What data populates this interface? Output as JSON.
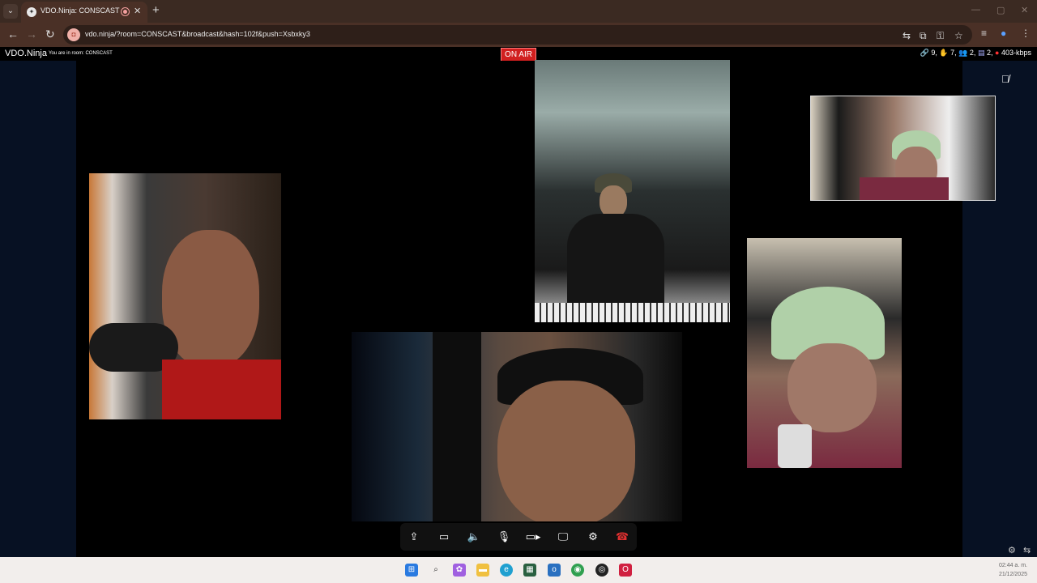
{
  "browser": {
    "tab_title": "VDO.Ninja: CONSCAST",
    "url": "vdo.ninja/?room=CONSCAST&broadcast&hash=102f&push=Xsbxky3"
  },
  "app": {
    "brand": "VDO.Ninja",
    "room_text": "You are in room: CONSCAST",
    "on_air": "ON AIR",
    "stats": {
      "links": "9,",
      "hands": "7,",
      "viewers": "2,",
      "directors": "2,",
      "bitrate": "403-kbps"
    }
  },
  "taskbar": {
    "time": "02:44 a. m.",
    "date": "21/12/2025"
  },
  "colors": {
    "on_air_bg": "#d11f1f",
    "tab_bar": "#3b2a22",
    "toolbar": "#4a3026",
    "stage_bg": "#071123",
    "hangup": "#e03030"
  }
}
